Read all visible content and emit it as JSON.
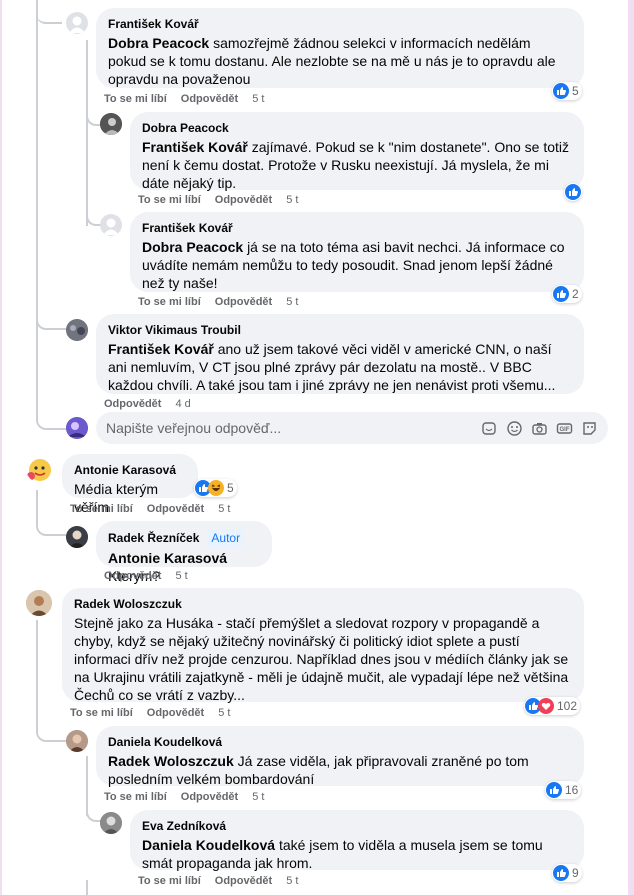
{
  "comments": [
    {
      "author": "František Kovář",
      "mention": "Dobra Peacock",
      "text": "samozřejmě žádnou selekci v informacích nedělám pokud se k tomu dostanu. Ale nezlobte se na mě u nás je to opravdu ale opravdu na považenou",
      "like": "To se mi líbí",
      "reply": "Odpovědět",
      "time": "5 t",
      "count": "5"
    },
    {
      "author": "Dobra Peacock",
      "mention": "František Kovář",
      "text": "zajímavé. Pokud se k \"nim dostanete\". Ono se totiž není k čemu dostat. Protože v Rusku neexistují. Já myslela, že mi dáte nějaký tip.",
      "like": "To se mi líbí",
      "reply": "Odpovědět",
      "time": "5 t"
    },
    {
      "author": "František Kovář",
      "mention": "Dobra Peacock",
      "text": "já se na toto téma asi bavit nechci. Já informace co uvádíte nemám nemůžu to tedy posoudit. Snad jenom lepší žádné než ty naše!",
      "like": "To se mi líbí",
      "reply": "Odpovědět",
      "time": "5 t",
      "count": "2"
    },
    {
      "author": "Viktor Vikimaus Troubil",
      "mention": "František Kovář",
      "text": "ano už jsem takové věci viděl v americké CNN, o naší ani nemluvím, V CT jsou plné zprávy pár dezolatu na mostě.. V BBC každou chvíli. A také jsou tam i jiné zprávy ne jen nenávist proti všemu...",
      "reply": "Odpovědět",
      "time": "4 d"
    },
    {
      "author": "Antonie Karasová",
      "text": "Média kterým věřím",
      "like": "To se mi líbí",
      "reply": "Odpovědět",
      "time": "5 t",
      "count": "5"
    },
    {
      "author": "Radek Řezníček",
      "badge": "Autor",
      "mention": "Antonie Karasová",
      "text": "Kterym?",
      "reply": "Odpovědět",
      "time": "5 t"
    },
    {
      "author": "Radek Woloszczuk",
      "text": "Stejně jako za Husáka - stačí přemýšlet a sledovat rozpory v propagandě a chyby, když se nějaký užitečný novinářský či politický idiot splete a pustí informaci dřív než projde cenzurou. Například dnes jsou v médiích články jak se na Ukrajinu vrátili zajatkyně - měli je údajně mučit, ale vypadají lépe než většina Čechů co se vrátí z vazby...",
      "like": "To se mi líbí",
      "reply": "Odpovědět",
      "time": "5 t",
      "count": "102"
    },
    {
      "author": "Daniela Koudelková",
      "mention": "Radek Woloszczuk",
      "text": "Já zase viděla, jak připravovali zraněné po tom posledním velkém bombardování",
      "like": "To se mi líbí",
      "reply": "Odpovědět",
      "time": "5 t",
      "count": "16"
    },
    {
      "author": "Eva Zedníková",
      "mention": "Daniela Koudelková",
      "text": "také jsem to viděla a musela jsem se tomu smát propaganda jak hrom.",
      "like": "To se mi líbí",
      "reply": "Odpovědět",
      "time": "5 t",
      "count": "9"
    }
  ],
  "reply_box": {
    "placeholder": "Napište veřejnou odpověď..."
  },
  "icons": {
    "like": "like-icon",
    "haha": "haha-icon",
    "love": "love-icon",
    "sticker": "sticker-icon",
    "emoji": "emoji-icon",
    "camera": "camera-icon",
    "gif": "gif-icon",
    "avatar": "avatar-sticker-icon"
  },
  "colors": {
    "like_blue": "#1877f2",
    "meta_gray": "#65676b",
    "bubble_bg": "#f0f2f5"
  }
}
